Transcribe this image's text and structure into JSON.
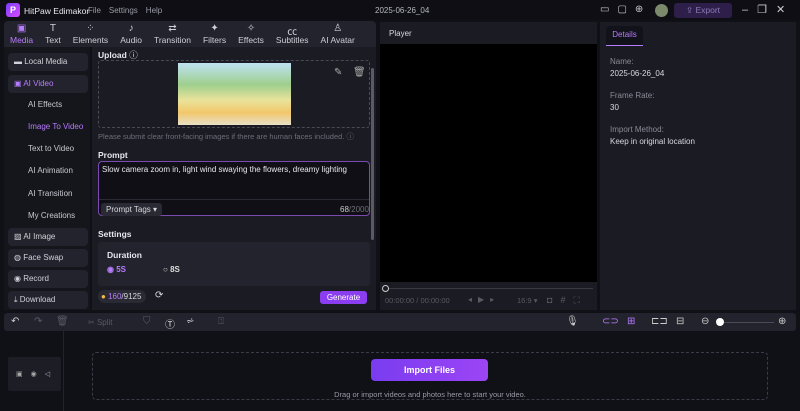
{
  "app": {
    "title": "HitPaw Edimakor",
    "menu": [
      "File",
      "Settings",
      "Help"
    ],
    "project": "2025-06-26_04",
    "export": "Export"
  },
  "toolbar": {
    "tabs": [
      {
        "label": "Media",
        "icon": "media-icon"
      },
      {
        "label": "Text",
        "icon": "text-icon"
      },
      {
        "label": "Elements",
        "icon": "elements-icon"
      },
      {
        "label": "Audio",
        "icon": "audio-icon"
      },
      {
        "label": "Transition",
        "icon": "transition-icon"
      },
      {
        "label": "Filters",
        "icon": "filters-icon"
      },
      {
        "label": "Effects",
        "icon": "effects-icon"
      },
      {
        "label": "Subtitles",
        "icon": "subtitles-icon"
      },
      {
        "label": "AI Avatar",
        "icon": "ai-avatar-icon"
      }
    ],
    "active": "Media"
  },
  "sidebar": {
    "items": [
      "Local Media",
      "AI Video",
      "AI Image",
      "Face Swap",
      "Record",
      "Download"
    ],
    "sub": [
      "AI Effects",
      "Image To Video",
      "Text to Video",
      "AI Animation",
      "AI Transition",
      "My Creations"
    ],
    "active_sub": "Image To Video"
  },
  "upload": {
    "label": "Upload",
    "hint": "Please submit clear front-facing images if there are human faces included."
  },
  "prompt": {
    "label": "Prompt",
    "value": "Slow camera zoom in, light wind swaying the flowers, dreamy lighting",
    "tags": "Prompt Tags",
    "count": "68",
    "max": "/2000"
  },
  "settings": {
    "label": "Settings",
    "duration": "Duration",
    "options": [
      "5S",
      "8S"
    ],
    "selected": "5S"
  },
  "credits": {
    "used": "160",
    "total": "/9125"
  },
  "generate": "Generate",
  "player": {
    "title": "Player",
    "time": "00:00:00",
    "total": "/ 00:00:00",
    "ratio": "16:9"
  },
  "details": {
    "tab": "Details",
    "fields": [
      {
        "label": "Name:",
        "value": "2025-06-26_04"
      },
      {
        "label": "Frame Rate:",
        "value": "30"
      },
      {
        "label": "Import Method:",
        "value": "Keep in original location"
      }
    ]
  },
  "timeline": {
    "split": "Split",
    "import": "Import Files",
    "hint": "Drag or import videos and photos here to start your video."
  },
  "colors": {
    "accent": "#a56bff",
    "generate": "#8b3df0"
  }
}
